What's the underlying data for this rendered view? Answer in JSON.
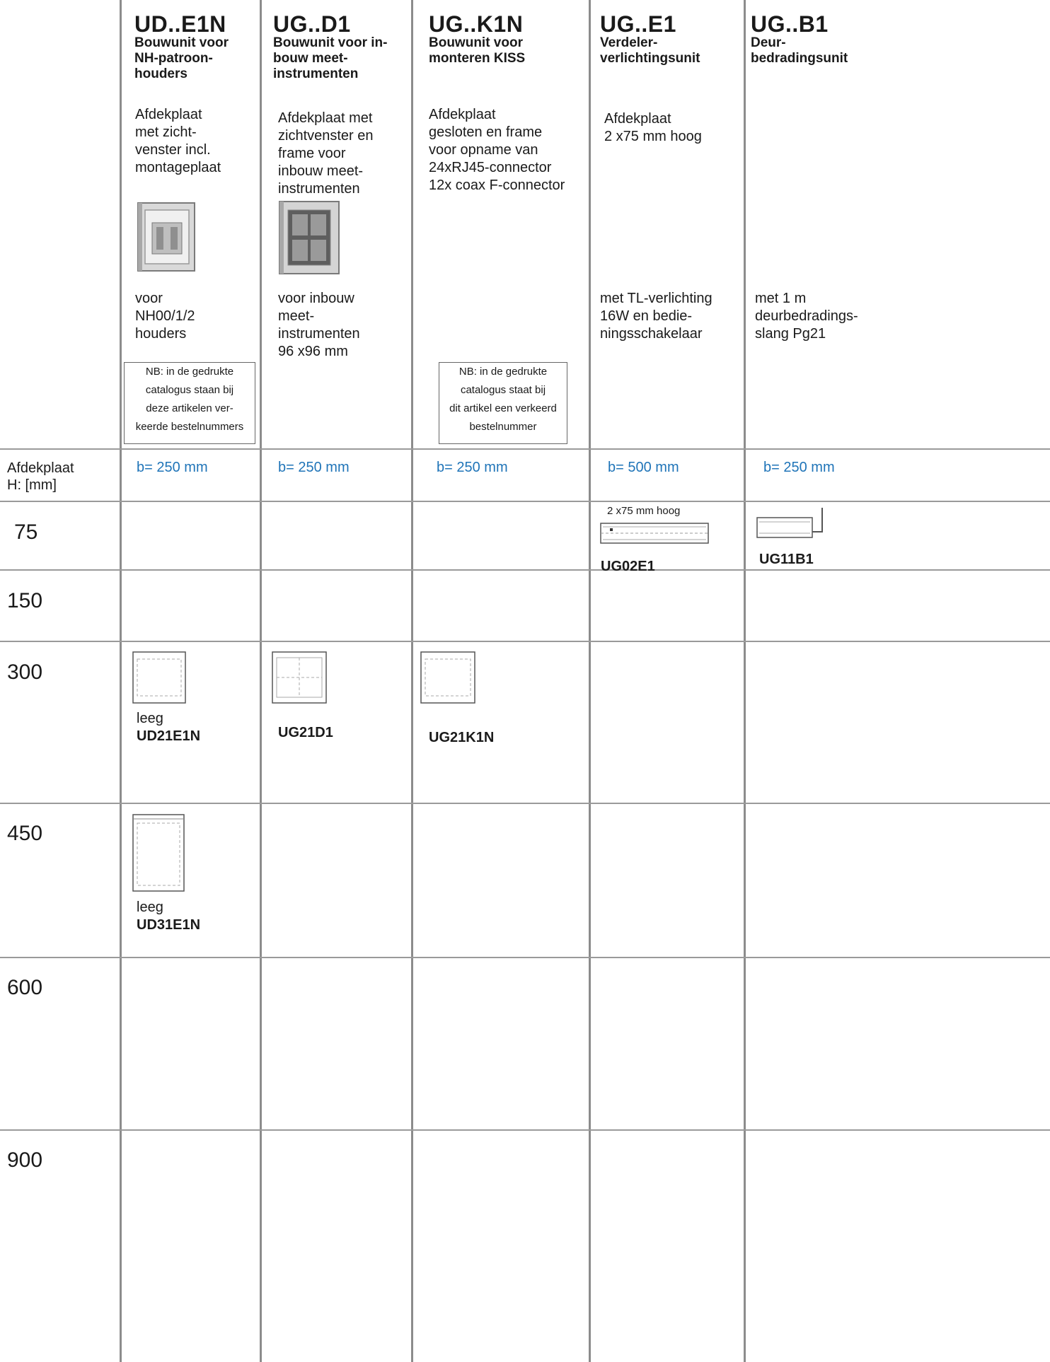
{
  "columns": [
    {
      "code": "UD..E1N",
      "subtitle": [
        "Bouwunit voor",
        "NH-patroon-",
        "houders"
      ],
      "description": [
        "Afdekplaat",
        "met zicht-",
        "venster incl.",
        "montageplaat"
      ],
      "detail": [
        "voor",
        "NH00/1/2",
        "houders"
      ],
      "note": [
        "NB: in de gedrukte",
        "catalogus staan bij",
        "deze artikelen ver-",
        "keerde bestelnummers"
      ],
      "width": "b= 250 mm"
    },
    {
      "code": "UG..D1",
      "subtitle": [
        "Bouwunit voor in-",
        "bouw meet-",
        "instrumenten"
      ],
      "description": [
        "Afdekplaat met",
        "zichtvenster en",
        "frame voor",
        "inbouw meet-",
        "instrumenten"
      ],
      "detail": [
        "voor inbouw",
        "meet-",
        "instrumenten",
        "96 x96 mm"
      ],
      "width": "b= 250 mm"
    },
    {
      "code": "UG..K1N",
      "subtitle": [
        "Bouwunit voor",
        "monteren KISS"
      ],
      "description": [
        "Afdekplaat",
        "gesloten en frame",
        "voor opname van",
        "24xRJ45-connector",
        "12x coax F-connector"
      ],
      "note": [
        "NB: in de gedrukte",
        "catalogus staat bij",
        "dit artikel een verkeerd",
        "bestelnummer"
      ],
      "width": "b= 250 mm"
    },
    {
      "code": "UG..E1",
      "subtitle": [
        "Verdeler-",
        "verlichtingsunit"
      ],
      "description": [
        "Afdekplaat",
        "2 x75 mm hoog"
      ],
      "detail": [
        "met TL-verlichting",
        "16W en bedie-",
        "ningsschakelaar"
      ],
      "width": "b= 500 mm"
    },
    {
      "code": "UG..B1",
      "subtitle": [
        "Deur-",
        "bedradingsunit"
      ],
      "detail": [
        "met 1 m",
        "deurbedradings-",
        "slang Pg21"
      ],
      "width": "b= 250 mm"
    }
  ],
  "row_header": {
    "line1": "Afdekplaat",
    "line2": "H: [mm]"
  },
  "heights": [
    "75",
    "150",
    "300",
    "450",
    "600",
    "900"
  ],
  "products": {
    "ug02e1": {
      "caption": "2 x75 mm hoog",
      "code": "UG02E1"
    },
    "ug11b1": {
      "code": "UG11B1"
    },
    "ud21e1n": {
      "label": "leeg",
      "code": "UD21E1N"
    },
    "ug21d1": {
      "code": "UG21D1"
    },
    "ug21k1n": {
      "code": "UG21K1N"
    },
    "ud31e1n": {
      "label": "leeg",
      "code": "UD31E1N"
    }
  },
  "colors": {
    "grid": "#8c8c8c",
    "accent": "#1f74b8",
    "text": "#1a1a1a"
  }
}
